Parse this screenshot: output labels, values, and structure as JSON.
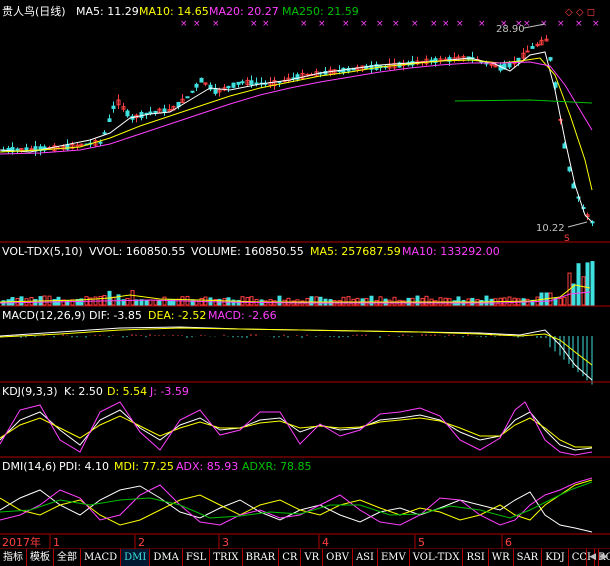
{
  "colors": {
    "bg": "#000000",
    "frame": "#b00000",
    "up": "#ff4040",
    "down": "#40e0e0",
    "white": "#ffffff",
    "yellow": "#ffff00",
    "magenta": "#ff40ff",
    "green": "#00c000",
    "gray": "#c0c0c0"
  },
  "price_panel": {
    "title": "贵人鸟(日线)",
    "ma5_label": "MA5: 11.29",
    "ma10_label": "MA10: 14.65",
    "ma20_label": "MA20: 20.27",
    "ma250_label": "MA250: 21.59",
    "high_label": "28.90",
    "low_label": "10.22",
    "flag_mark": "S",
    "corner_icons": "◇ ◇ ◻"
  },
  "volume_panel": {
    "title": "VOL-TDX(5,10)",
    "vvol_label": "VVOL: 160850.55",
    "volume_label": "VOLUME: 160850.55",
    "ma5_label": "MA5: 257687.59",
    "ma10_label": "MA10: 133292.00"
  },
  "macd_panel": {
    "title": "MACD(12,26,9)",
    "dif_label": "DIF: -3.85",
    "dea_label": "DEA: -2.52",
    "macd_label": "MACD: -2.66"
  },
  "kdj_panel": {
    "title": "KDJ(9,3,3)",
    "k_label": "K: 2.50",
    "d_label": "D: 5.54",
    "j_label": "J: -3.59"
  },
  "dmi_panel": {
    "title": "DMI(14,6)",
    "pdi_label": "PDI: 4.10",
    "mdi_label": "MDI: 77.25",
    "adx_label": "ADX: 85.93",
    "adxr_label": "ADXR: 78.85"
  },
  "time_axis": {
    "year_label": "2017年",
    "months": [
      "1",
      "2",
      "3",
      "4",
      "5",
      "6"
    ]
  },
  "tabs": [
    "指标",
    "模板",
    "全部",
    "MACD",
    "DMI",
    "DMA",
    "FSL",
    "TRIX",
    "BRAR",
    "CR",
    "VR",
    "OBV",
    "ASI",
    "EMV",
    "VOL-TDX",
    "RSI",
    "WR",
    "SAR",
    "KDJ",
    "CCI",
    "ROC"
  ],
  "active_tab": "DMI",
  "nav": {
    "prev": "◀",
    "next": "▶"
  }
}
